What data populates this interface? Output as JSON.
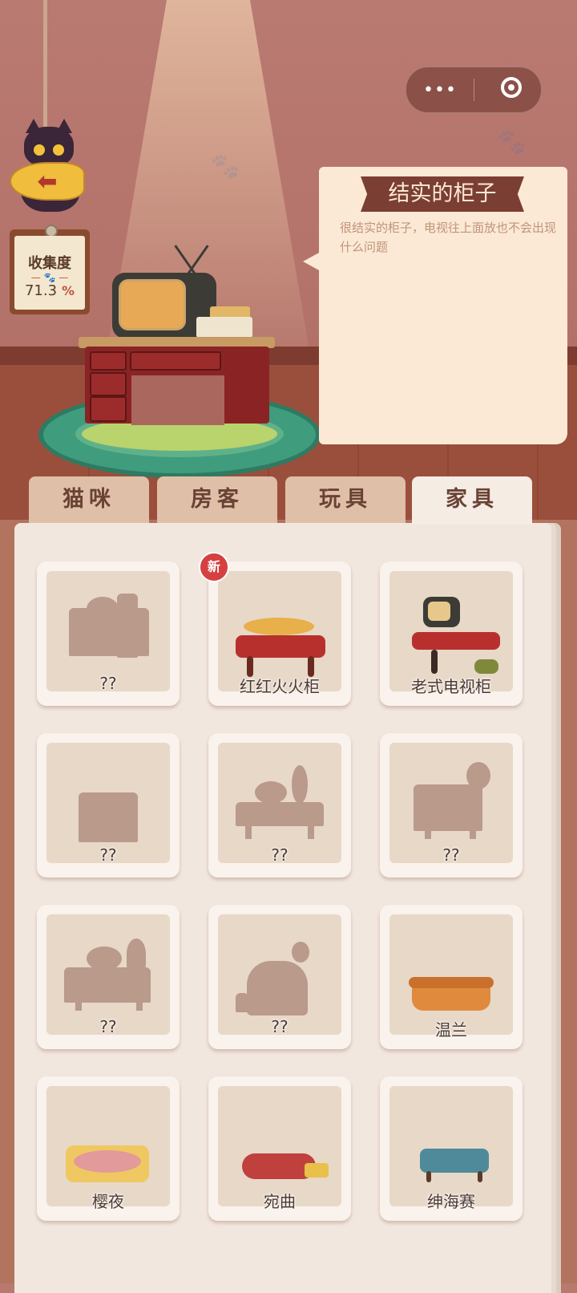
{
  "menu": {
    "more_label": "•••"
  },
  "collection": {
    "title": "收集度",
    "value": "71.3",
    "unit": "%"
  },
  "detail": {
    "title": "结实的柜子",
    "description": "很结实的柜子，电视往上面放也不会出现什么问题"
  },
  "tabs": [
    {
      "label": "猫咪"
    },
    {
      "label": "房客"
    },
    {
      "label": "玩具"
    },
    {
      "label": "家具"
    }
  ],
  "active_tab": "家具",
  "items": [
    {
      "label": "??",
      "unlocked": false
    },
    {
      "label": "红红火火柜",
      "unlocked": true,
      "badge": "新"
    },
    {
      "label": "老式电视柜",
      "unlocked": true
    },
    {
      "label": "??",
      "unlocked": false
    },
    {
      "label": "??",
      "unlocked": false
    },
    {
      "label": "??",
      "unlocked": false
    },
    {
      "label": "??",
      "unlocked": false
    },
    {
      "label": "??",
      "unlocked": false
    },
    {
      "label": "温兰",
      "unlocked": true
    },
    {
      "label": "樱夜",
      "unlocked": true
    },
    {
      "label": "宛曲",
      "unlocked": true
    },
    {
      "label": "绅海赛",
      "unlocked": true
    }
  ],
  "colors": {
    "accent": "#7b3e33",
    "badge": "#d64040",
    "panel": "#fbe9d6"
  }
}
